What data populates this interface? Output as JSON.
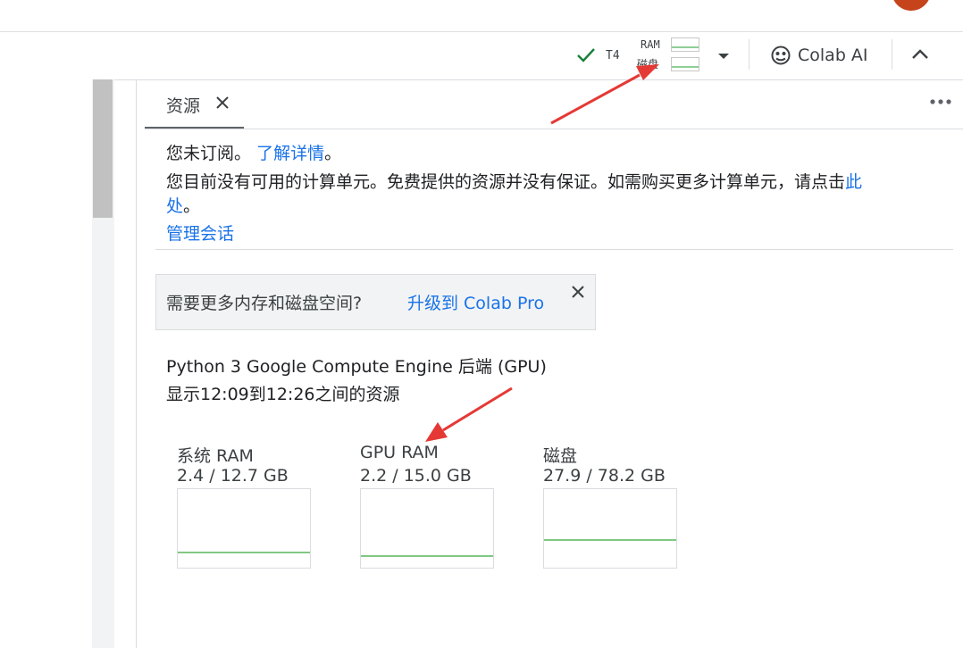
{
  "header": {
    "runtime": {
      "accelerator": "T4",
      "ram_label": "RAM",
      "disk_label": "磁盘",
      "ram_level": 0.3,
      "disk_level": 0.3
    },
    "colab_ai_label": "Colab AI"
  },
  "panel": {
    "tab_label": "资源",
    "subscription_text": "您未订阅。",
    "learn_more_link": "了解详情",
    "learn_more_suffix": "。",
    "units_text": "您目前没有可用的计算单元。免费提供的资源并没有保证。如需购买更多计算单元，请点击",
    "here_link_part1": "此",
    "here_link_part2": "处",
    "units_suffix": "。",
    "manage_sessions_link": "管理会话",
    "upgrade_prompt": "需要更多内存和磁盘空间?",
    "upgrade_link": "升级到 Colab Pro",
    "backend": "Python 3 Google Compute Engine 后端 (GPU)",
    "time_range": "显示12:09到12:26之间的资源"
  },
  "metrics": [
    {
      "title": "系统 RAM",
      "value": "2.4 / 12.7 GB",
      "used_fraction": 0.19
    },
    {
      "title": "GPU RAM",
      "value": "2.2 / 15.0 GB",
      "used_fraction": 0.147
    },
    {
      "title": "磁盘",
      "value": "27.9 / 78.2 GB",
      "used_fraction": 0.357
    }
  ],
  "colors": {
    "accent_link": "#1a73e8",
    "chart_line": "#81c784",
    "check": "#188038",
    "arrow": "#e53935"
  }
}
